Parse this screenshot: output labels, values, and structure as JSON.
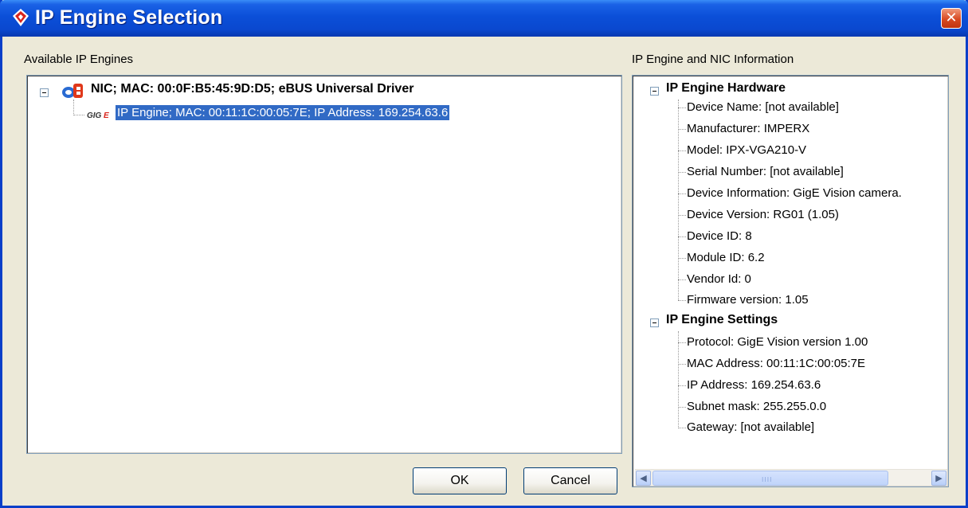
{
  "window": {
    "title": "IP Engine Selection",
    "close_glyph": "✕"
  },
  "left_panel": {
    "label": "Available IP Engines",
    "nic": {
      "icon_text": "eB",
      "label": "NIC; MAC: 00:0F:B5:45:9D:D5; eBUS Universal Driver"
    },
    "engine": {
      "icon_text": "GIGE",
      "label": "IP Engine; MAC: 00:11:1C:00:05:7E; IP Address: 169.254.63.6"
    }
  },
  "right_panel": {
    "label": "IP Engine and NIC Information",
    "hardware": {
      "title": "IP Engine Hardware",
      "items": [
        "Device Name: [not available]",
        "Manufacturer: IMPERX",
        "Model: IPX-VGA210-V",
        "Serial Number: [not available]",
        "Device Information: GigE Vision camera.",
        "Device Version: RG01 (1.05)",
        "Device ID: 8",
        "Module ID: 6.2",
        "Vendor Id: 0",
        "Firmware version: 1.05"
      ]
    },
    "settings": {
      "title": "IP Engine Settings",
      "items": [
        "Protocol: GigE Vision version 1.00",
        "MAC Address: 00:11:1C:00:05:7E",
        "IP Address: 169.254.63.6",
        "Subnet mask: 255.255.0.0",
        "Gateway: [not available]"
      ]
    }
  },
  "buttons": {
    "ok": "OK",
    "cancel": "Cancel"
  },
  "scrollbar": {
    "left_arrow": "◀",
    "right_arrow": "▶",
    "grip": "IIII"
  },
  "colors": {
    "title_bar": "#0a48cf",
    "selection": "#316ac5",
    "dialog_bg": "#ece9d8"
  }
}
